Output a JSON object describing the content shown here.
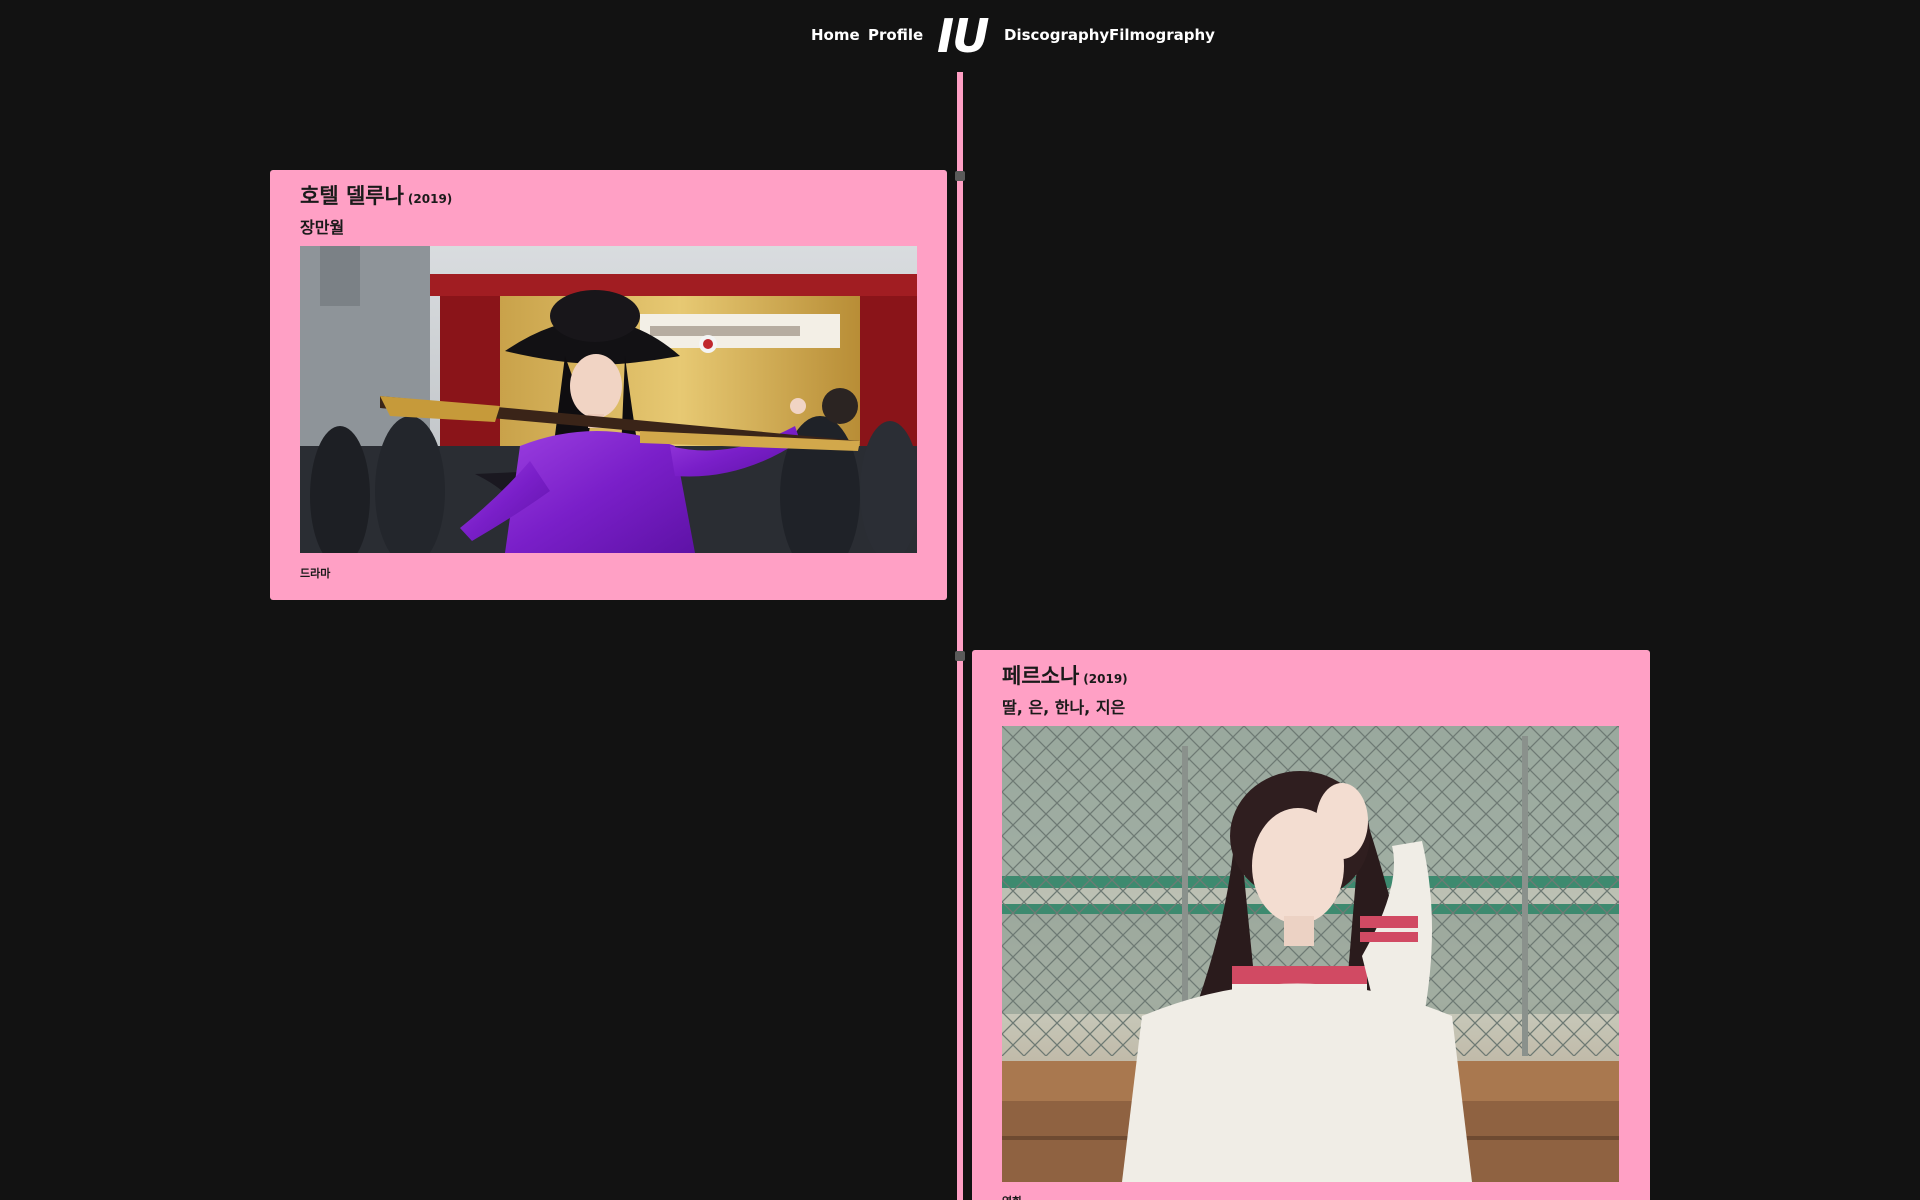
{
  "nav": {
    "home": "Home",
    "profile": "Profile",
    "logo": "IU",
    "discography": "Discography",
    "filmography": "Filmography"
  },
  "colors": {
    "background": "#121212",
    "accent_pink": "#ffa0c5",
    "timeline": "#ff9fc4"
  },
  "filmography": [
    {
      "title": "호텔 델루나",
      "year": "(2019)",
      "role": "장만월",
      "genre": "드라마",
      "image": "still-woman-purple-dress-black-hat-rifle-auditorium"
    },
    {
      "title": "페르소나",
      "year": "(2019)",
      "role": "딸, 은, 한나, 지은",
      "genre": "영화",
      "image": "still-woman-white-sweater-bench-chainlink-fence"
    }
  ]
}
